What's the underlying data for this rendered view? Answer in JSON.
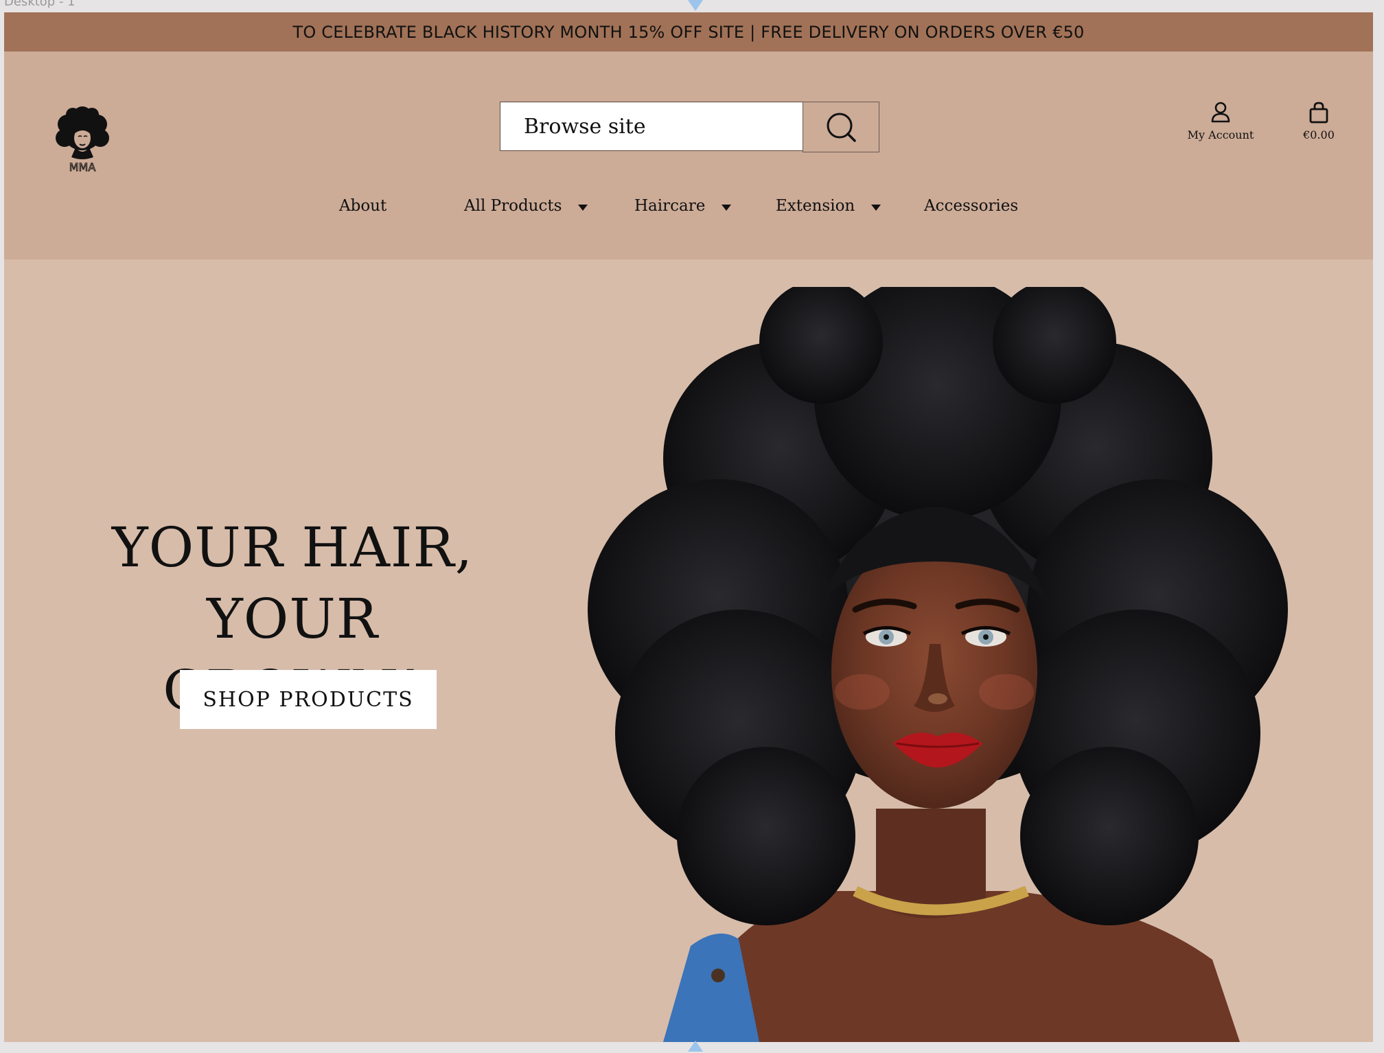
{
  "frame": {
    "label": "Desktop - 1"
  },
  "promo": {
    "text": "TO CELEBRATE BLACK HISTORY MONTH 15% OFF SITE | FREE DELIVERY ON ORDERS OVER €50"
  },
  "header": {
    "logo_text": "MMA",
    "search": {
      "placeholder": "Browse site",
      "icon": "search-icon"
    },
    "account": {
      "label": "My Account",
      "icon": "user-icon"
    },
    "cart": {
      "label": "€0.00",
      "icon": "shopping-bag-icon"
    }
  },
  "nav": {
    "items": [
      {
        "label": "About",
        "has_dropdown": false
      },
      {
        "label": "All Products",
        "has_dropdown": true
      },
      {
        "label": "Haircare",
        "has_dropdown": true
      },
      {
        "label": "Extension",
        "has_dropdown": true
      },
      {
        "label": "Accessories",
        "has_dropdown": false
      }
    ]
  },
  "hero": {
    "headline_line1": "YOUR HAIR,",
    "headline_line2": "YOUR CROWN!",
    "cta_label": "SHOP PRODUCTS"
  },
  "colors": {
    "promo_bar": "#a17257",
    "header_bg": "#ccab97",
    "hero_bg": "#d7bcaa",
    "text": "#111111",
    "button_bg": "#ffffff"
  }
}
